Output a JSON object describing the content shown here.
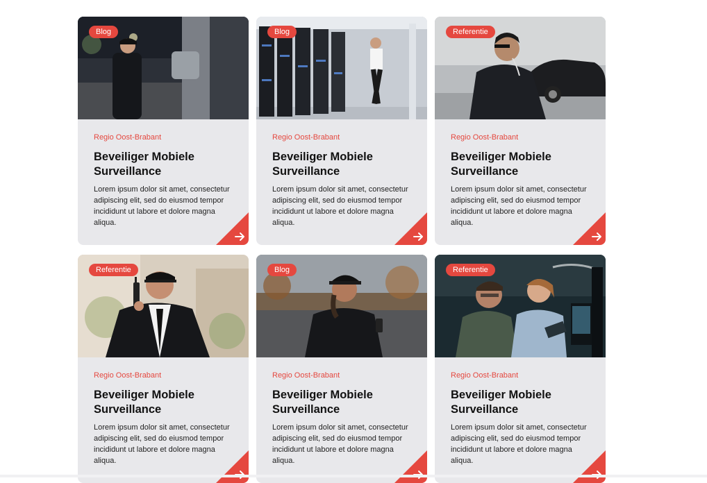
{
  "colors": {
    "accent": "#e5483f",
    "card_bg": "#e8e8eb"
  },
  "cards": [
    {
      "badge": "Blog",
      "region": "Regio Oost-Brabant",
      "title": "Beveiliger Mobiele Surveillance",
      "description": "Lorem ipsum dolor sit amet, consectetur adipiscing elit, sed do eiusmod tempor incididunt ut labore et dolore magna aliqua.",
      "image": "guard-at-night-with-radio",
      "arrow_icon": "arrow-right-icon"
    },
    {
      "badge": "Blog",
      "region": "Regio Oost-Brabant",
      "title": "Beveiliger Mobiele Surveillance",
      "description": "Lorem ipsum dolor sit amet, consectetur adipiscing elit, sed do eiusmod tempor incididunt ut labore et dolore magna aliqua.",
      "image": "guard-in-server-room",
      "arrow_icon": "arrow-right-icon"
    },
    {
      "badge": "Referentie",
      "region": "Regio Oost-Brabant",
      "title": "Beveiliger Mobiele Surveillance",
      "description": "Lorem ipsum dolor sit amet, consectetur adipiscing elit, sed do eiusmod tempor incididunt ut labore et dolore magna aliqua.",
      "image": "bodyguard-in-suit-with-earpiece",
      "arrow_icon": "arrow-right-icon"
    },
    {
      "badge": "Referentie",
      "region": "Regio Oost-Brabant",
      "title": "Beveiliger Mobiele Surveillance",
      "description": "Lorem ipsum dolor sit amet, consectetur adipiscing elit, sed do eiusmod tempor incididunt ut labore et dolore magna aliqua.",
      "image": "security-guard-with-walkie-talkie",
      "arrow_icon": "arrow-right-icon"
    },
    {
      "badge": "Blog",
      "region": "Regio Oost-Brabant",
      "title": "Beveiliger Mobiele Surveillance",
      "description": "Lorem ipsum dolor sit amet, consectetur adipiscing elit, sed do eiusmod tempor incididunt ut labore et dolore magna aliqua.",
      "image": "smiling-female-guard-outdoors",
      "arrow_icon": "arrow-right-icon"
    },
    {
      "badge": "Referentie",
      "region": "Regio Oost-Brabant",
      "title": "Beveiliger Mobiele Surveillance",
      "description": "Lorem ipsum dolor sit amet, consectetur adipiscing elit, sed do eiusmod tempor incididunt ut labore et dolore magna aliqua.",
      "image": "operators-at-monitoring-screens",
      "arrow_icon": "arrow-right-icon"
    }
  ]
}
